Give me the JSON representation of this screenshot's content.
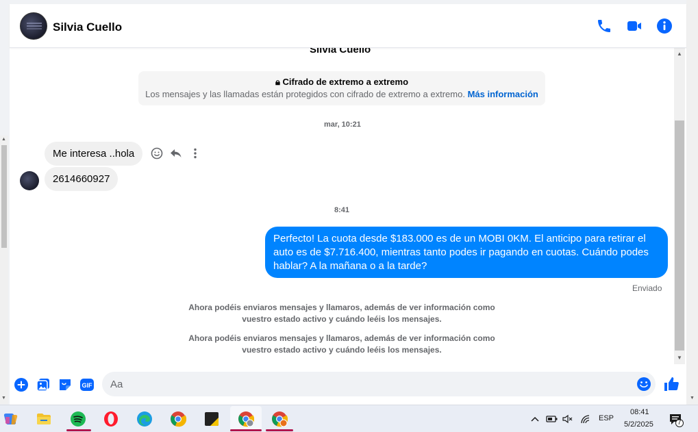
{
  "header": {
    "contact_name": "Silvia Cuello"
  },
  "thread": {
    "name_behind_header": "Silvia Cuello",
    "encryption": {
      "title": "Cifrado de extremo a extremo",
      "description": "Los mensajes y las llamadas están protegidos con cifrado de extremo a extremo.",
      "link_label": "Más información"
    },
    "timestamp_1": "mar, 10:21",
    "incoming_1": "Me interesa  ..hola",
    "incoming_2": "2614660927",
    "timestamp_2": "8:41",
    "outgoing_1": "Perfecto! La cuota desde $183.000 es de un MOBI 0KM. El anticipo para retirar el auto es de $7.716.400, mientras tanto podes ir pagando en cuotas. Cuándo podes hablar? A la mañana o a la tarde?",
    "sent_status": "Enviado",
    "notice_1": "Ahora podéis enviaros mensajes y llamaros, además de ver información como vuestro estado activo y cuándo leéis los mensajes.",
    "notice_2": "Ahora podéis enviaros mensajes y llamaros, además de ver información como vuestro estado activo y cuándo leéis los mensajes."
  },
  "composer": {
    "placeholder": "Aa",
    "gif_label": "GIF"
  },
  "taskbar": {
    "language": "ESP",
    "time": "08:41",
    "date": "5/2/2025",
    "notification_count": "7"
  },
  "colors": {
    "accent": "#0084ff",
    "brand_blue": "#0866ff",
    "incoming_bubble": "#f0f0f0"
  },
  "icons": {
    "header": [
      "phone-icon",
      "video-camera-icon",
      "info-icon"
    ],
    "message_actions": [
      "emoji-react-icon",
      "reply-icon",
      "more-options-icon"
    ],
    "composer": [
      "plus-icon",
      "gallery-icon",
      "sticker-icon",
      "gif-icon",
      "emoji-icon",
      "like-icon"
    ],
    "taskbar": [
      "copilot-icon",
      "file-explorer-icon",
      "spotify-icon",
      "opera-icon",
      "edge-icon",
      "chrome-icon",
      "sticky-notes-icon",
      "chrome-profile-icon",
      "chrome-profile-icon-2"
    ]
  }
}
